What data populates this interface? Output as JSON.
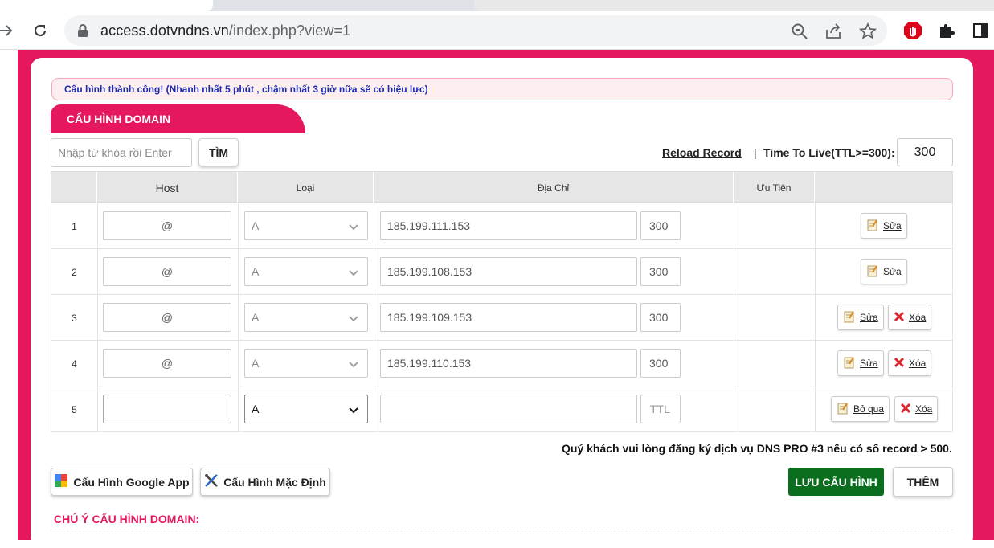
{
  "browser": {
    "url_host": "access.dotvndns.vn",
    "url_path": "/index.php?view=1"
  },
  "alert": {
    "text": "Cấu hình thành công! (Nhanh nhất 5 phút , chậm nhất 3 giờ nữa sẽ có hiệu lực)"
  },
  "section": {
    "title": "CẤU HÌNH DOMAIN"
  },
  "search": {
    "placeholder": "Nhập từ khóa rồi Enter",
    "button": "TÌM"
  },
  "toolbar": {
    "reload": "Reload Record",
    "separator": "|",
    "ttl_label": "Time To Live(TTL>=300):",
    "ttl_value": "300"
  },
  "table": {
    "headers": {
      "host": "Host",
      "type": "Loại",
      "address": "Địa Chỉ",
      "priority": "Ưu Tiên"
    },
    "rows": [
      {
        "no": "1",
        "host": "@",
        "type": "A",
        "address": "185.199.111.153",
        "ttl": "300",
        "edit": "Sửa"
      },
      {
        "no": "2",
        "host": "@",
        "type": "A",
        "address": "185.199.108.153",
        "ttl": "300",
        "edit": "Sửa"
      },
      {
        "no": "3",
        "host": "@",
        "type": "A",
        "address": "185.199.109.153",
        "ttl": "300",
        "edit": "Sửa",
        "delete": "Xóa"
      },
      {
        "no": "4",
        "host": "@",
        "type": "A",
        "address": "185.199.110.153",
        "ttl": "300",
        "edit": "Sửa",
        "delete": "Xóa"
      },
      {
        "no": "5",
        "host": "",
        "type": "A",
        "address": "",
        "ttl_placeholder": "TTL",
        "skip": "Bỏ qua",
        "delete": "Xóa"
      }
    ]
  },
  "note": "Quý khách vui lòng đăng ký dịch vụ DNS PRO #3 nếu có số record > 500.",
  "buttons": {
    "google_app": "Cấu Hình Google App",
    "default_config": "Cấu Hình Mặc Định",
    "save": "LƯU CẤU HÌNH",
    "add": "THÊM"
  },
  "notes_heading": "CHÚ Ý CẤU HÌNH DOMAIN:",
  "colors": {
    "brand": "#e4175f",
    "save": "#0b6d1e",
    "alert_text": "#1d2bb0"
  }
}
